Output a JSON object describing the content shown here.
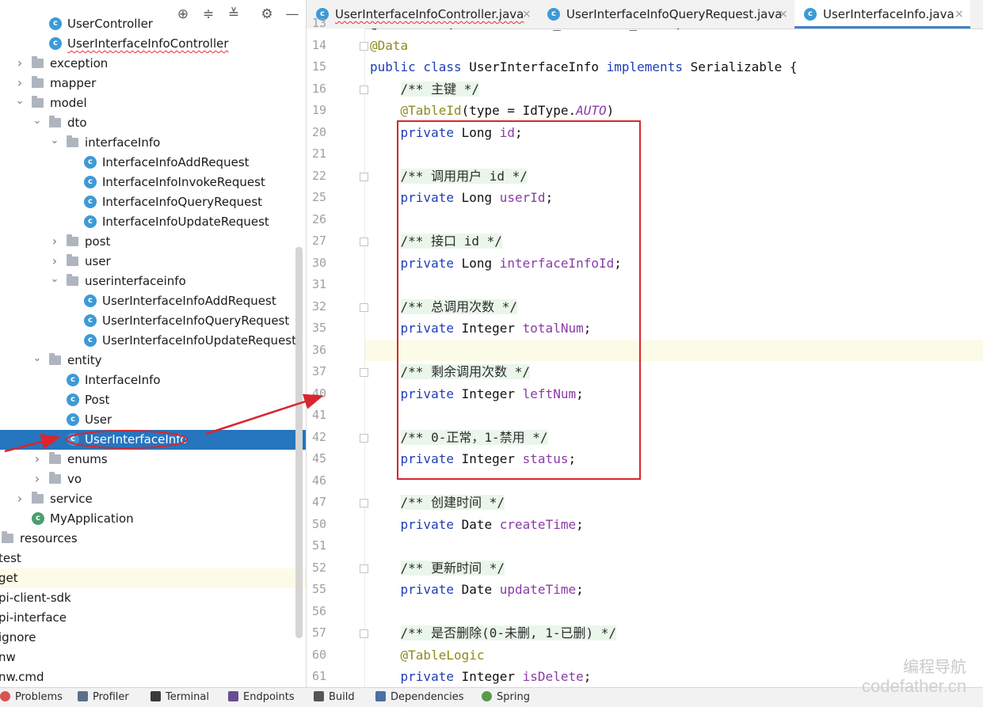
{
  "project_tree": {
    "toolbar_icons": [
      "locate-icon",
      "expand-all-icon",
      "collapse-all-icon",
      "gear-icon",
      "minimize-icon"
    ],
    "rows": [
      {
        "label": "UserController",
        "indent": 3,
        "kind": "class",
        "twisty": ""
      },
      {
        "label": "UserInterfaceInfoController",
        "indent": 3,
        "kind": "class",
        "twisty": "",
        "wavy": true
      },
      {
        "label": "exception",
        "indent": 2,
        "kind": "folder",
        "twisty": "›"
      },
      {
        "label": "mapper",
        "indent": 2,
        "kind": "folder",
        "twisty": "›"
      },
      {
        "label": "model",
        "indent": 2,
        "kind": "folder",
        "twisty": "⌄"
      },
      {
        "label": "dto",
        "indent": 3,
        "kind": "folder",
        "twisty": "⌄"
      },
      {
        "label": "interfaceInfo",
        "indent": 4,
        "kind": "folder",
        "twisty": "⌄"
      },
      {
        "label": "InterfaceInfoAddRequest",
        "indent": 5,
        "kind": "class",
        "twisty": ""
      },
      {
        "label": "InterfaceInfoInvokeRequest",
        "indent": 5,
        "kind": "class",
        "twisty": ""
      },
      {
        "label": "InterfaceInfoQueryRequest",
        "indent": 5,
        "kind": "class",
        "twisty": ""
      },
      {
        "label": "InterfaceInfoUpdateRequest",
        "indent": 5,
        "kind": "class",
        "twisty": ""
      },
      {
        "label": "post",
        "indent": 4,
        "kind": "folder",
        "twisty": "›"
      },
      {
        "label": "user",
        "indent": 4,
        "kind": "folder",
        "twisty": "›"
      },
      {
        "label": "userinterfaceinfo",
        "indent": 4,
        "kind": "folder",
        "twisty": "⌄"
      },
      {
        "label": "UserInterfaceInfoAddRequest",
        "indent": 5,
        "kind": "class",
        "twisty": ""
      },
      {
        "label": "UserInterfaceInfoQueryRequest",
        "indent": 5,
        "kind": "class",
        "twisty": ""
      },
      {
        "label": "UserInterfaceInfoUpdateRequest",
        "indent": 5,
        "kind": "class",
        "twisty": ""
      },
      {
        "label": "entity",
        "indent": 3,
        "kind": "folder",
        "twisty": "⌄"
      },
      {
        "label": "InterfaceInfo",
        "indent": 4,
        "kind": "class",
        "twisty": ""
      },
      {
        "label": "Post",
        "indent": 4,
        "kind": "class",
        "twisty": ""
      },
      {
        "label": "User",
        "indent": 4,
        "kind": "class",
        "twisty": ""
      },
      {
        "label": "UserInterfaceInfo",
        "indent": 4,
        "kind": "class",
        "twisty": "",
        "selected": true
      },
      {
        "label": "enums",
        "indent": 3,
        "kind": "folder",
        "twisty": "›"
      },
      {
        "label": "vo",
        "indent": 3,
        "kind": "folder",
        "twisty": "›"
      },
      {
        "label": "service",
        "indent": 2,
        "kind": "folder",
        "twisty": "›"
      },
      {
        "label": "MyApplication",
        "indent": 2,
        "kind": "app",
        "twisty": ""
      },
      {
        "label": "resources",
        "indent": 0,
        "kind": "folder",
        "twisty": ""
      },
      {
        "label": "test",
        "indent": -1,
        "kind": "none",
        "twisty": ""
      },
      {
        "label": "get",
        "indent": -1,
        "kind": "none",
        "twisty": "",
        "highlight": true
      },
      {
        "label": "pi-client-sdk",
        "indent": -1,
        "kind": "none",
        "twisty": ""
      },
      {
        "label": "pi-interface",
        "indent": -1,
        "kind": "none",
        "twisty": ""
      },
      {
        "label": "ignore",
        "indent": -1,
        "kind": "none",
        "twisty": ""
      },
      {
        "label": "nw",
        "indent": -1,
        "kind": "none",
        "twisty": ""
      },
      {
        "label": "nw.cmd",
        "indent": -1,
        "kind": "none",
        "twisty": ""
      }
    ]
  },
  "tabs": [
    {
      "label": "UserInterfaceInfoController.java",
      "active": false,
      "wavy": true
    },
    {
      "label": "UserInterfaceInfoQueryRequest.java",
      "active": false
    },
    {
      "label": "UserInterfaceInfo.java",
      "active": true
    }
  ],
  "editor": {
    "lines": [
      {
        "n": "13",
        "fold": false,
        "parts": [
          [
            "",
            "@TableName(value = \"user_interface_info\")"
          ]
        ]
      },
      {
        "n": "14",
        "fold": true,
        "parts": [
          [
            "ann",
            "@Data"
          ]
        ]
      },
      {
        "n": "15",
        "fold": false,
        "parts": [
          [
            "kw",
            "public class "
          ],
          [
            "",
            "UserInterfaceInfo "
          ],
          [
            "kw",
            "implements "
          ],
          [
            "",
            "Serializable {"
          ]
        ]
      },
      {
        "n": "16",
        "fold": true,
        "parts": [
          [
            "",
            "    "
          ],
          [
            "cm",
            "/** 主键 */"
          ]
        ]
      },
      {
        "n": "19",
        "fold": false,
        "parts": [
          [
            "",
            "    "
          ],
          [
            "ann",
            "@TableId"
          ],
          [
            "",
            "(type = IdType."
          ],
          [
            "anni",
            "AUTO"
          ],
          [
            "",
            ")"
          ]
        ]
      },
      {
        "n": "20",
        "fold": false,
        "parts": [
          [
            "",
            "    "
          ],
          [
            "kw",
            "private "
          ],
          [
            "",
            "Long "
          ],
          [
            "fld",
            "id"
          ],
          [
            "",
            ";"
          ]
        ]
      },
      {
        "n": "21",
        "fold": false,
        "parts": [
          [
            "",
            ""
          ]
        ]
      },
      {
        "n": "22",
        "fold": true,
        "parts": [
          [
            "",
            "    "
          ],
          [
            "cm",
            "/** 调用用户 id */"
          ]
        ]
      },
      {
        "n": "25",
        "fold": false,
        "parts": [
          [
            "",
            "    "
          ],
          [
            "kw",
            "private "
          ],
          [
            "",
            "Long "
          ],
          [
            "fld",
            "userId"
          ],
          [
            "",
            ";"
          ]
        ]
      },
      {
        "n": "26",
        "fold": false,
        "parts": [
          [
            "",
            ""
          ]
        ]
      },
      {
        "n": "27",
        "fold": true,
        "parts": [
          [
            "",
            "    "
          ],
          [
            "cm",
            "/** 接口 id */"
          ]
        ]
      },
      {
        "n": "30",
        "fold": false,
        "parts": [
          [
            "",
            "    "
          ],
          [
            "kw",
            "private "
          ],
          [
            "",
            "Long "
          ],
          [
            "fld",
            "interfaceInfoId"
          ],
          [
            "",
            ";"
          ]
        ]
      },
      {
        "n": "31",
        "fold": false,
        "parts": [
          [
            "",
            ""
          ]
        ]
      },
      {
        "n": "32",
        "fold": true,
        "parts": [
          [
            "",
            "    "
          ],
          [
            "cm",
            "/** 总调用次数 */"
          ]
        ]
      },
      {
        "n": "35",
        "fold": false,
        "parts": [
          [
            "",
            "    "
          ],
          [
            "kw",
            "private "
          ],
          [
            "",
            "Integer "
          ],
          [
            "fld",
            "totalNum"
          ],
          [
            "",
            ";"
          ]
        ]
      },
      {
        "n": "36",
        "fold": false,
        "current": true,
        "parts": [
          [
            "",
            ""
          ]
        ]
      },
      {
        "n": "37",
        "fold": true,
        "parts": [
          [
            "",
            "    "
          ],
          [
            "cm",
            "/** 剩余调用次数 */"
          ]
        ]
      },
      {
        "n": "40",
        "fold": false,
        "parts": [
          [
            "",
            "    "
          ],
          [
            "kw",
            "private "
          ],
          [
            "",
            "Integer "
          ],
          [
            "fld",
            "leftNum"
          ],
          [
            "",
            ";"
          ]
        ]
      },
      {
        "n": "41",
        "fold": false,
        "parts": [
          [
            "",
            ""
          ]
        ]
      },
      {
        "n": "42",
        "fold": true,
        "parts": [
          [
            "",
            "    "
          ],
          [
            "cm",
            "/** 0-正常，1-禁用 */"
          ]
        ]
      },
      {
        "n": "45",
        "fold": false,
        "parts": [
          [
            "",
            "    "
          ],
          [
            "kw",
            "private "
          ],
          [
            "",
            "Integer "
          ],
          [
            "fld",
            "status"
          ],
          [
            "",
            ";"
          ]
        ]
      },
      {
        "n": "46",
        "fold": false,
        "parts": [
          [
            "",
            ""
          ]
        ]
      },
      {
        "n": "47",
        "fold": true,
        "parts": [
          [
            "",
            "    "
          ],
          [
            "cm",
            "/** 创建时间 */"
          ]
        ]
      },
      {
        "n": "50",
        "fold": false,
        "parts": [
          [
            "",
            "    "
          ],
          [
            "kw",
            "private "
          ],
          [
            "",
            "Date "
          ],
          [
            "fld",
            "createTime"
          ],
          [
            "",
            ";"
          ]
        ]
      },
      {
        "n": "51",
        "fold": false,
        "parts": [
          [
            "",
            ""
          ]
        ]
      },
      {
        "n": "52",
        "fold": true,
        "parts": [
          [
            "",
            "    "
          ],
          [
            "cm",
            "/** 更新时间 */"
          ]
        ]
      },
      {
        "n": "55",
        "fold": false,
        "parts": [
          [
            "",
            "    "
          ],
          [
            "kw",
            "private "
          ],
          [
            "",
            "Date "
          ],
          [
            "fld",
            "updateTime"
          ],
          [
            "",
            ";"
          ]
        ]
      },
      {
        "n": "56",
        "fold": false,
        "parts": [
          [
            "",
            ""
          ]
        ]
      },
      {
        "n": "57",
        "fold": true,
        "parts": [
          [
            "",
            "    "
          ],
          [
            "cm",
            "/** 是否删除(0-未删, 1-已删) */"
          ]
        ]
      },
      {
        "n": "60",
        "fold": false,
        "parts": [
          [
            "",
            "    "
          ],
          [
            "ann",
            "@TableLogic"
          ]
        ]
      },
      {
        "n": "61",
        "fold": false,
        "parts": [
          [
            "",
            "    "
          ],
          [
            "kw",
            "private "
          ],
          [
            "",
            "Integer "
          ],
          [
            "fld",
            "isDelete"
          ],
          [
            "",
            ";"
          ]
        ]
      }
    ]
  },
  "status_bar": [
    {
      "label": "Problems",
      "icon": "problems-icon"
    },
    {
      "label": "Profiler",
      "icon": "profiler-icon"
    },
    {
      "label": "Terminal",
      "icon": "terminal-icon"
    },
    {
      "label": "Endpoints",
      "icon": "endpoints-icon"
    },
    {
      "label": "Build",
      "icon": "build-icon"
    },
    {
      "label": "Dependencies",
      "icon": "dependencies-icon"
    },
    {
      "label": "Spring",
      "icon": "spring-icon"
    }
  ],
  "watermark": {
    "line1": "编程导航",
    "line2": "codefather.cn"
  },
  "colors": {
    "selection": "#2675bf",
    "annotation_red": "#d8262e",
    "keyword": "#1f3eb3",
    "field": "#8a3ba7"
  }
}
